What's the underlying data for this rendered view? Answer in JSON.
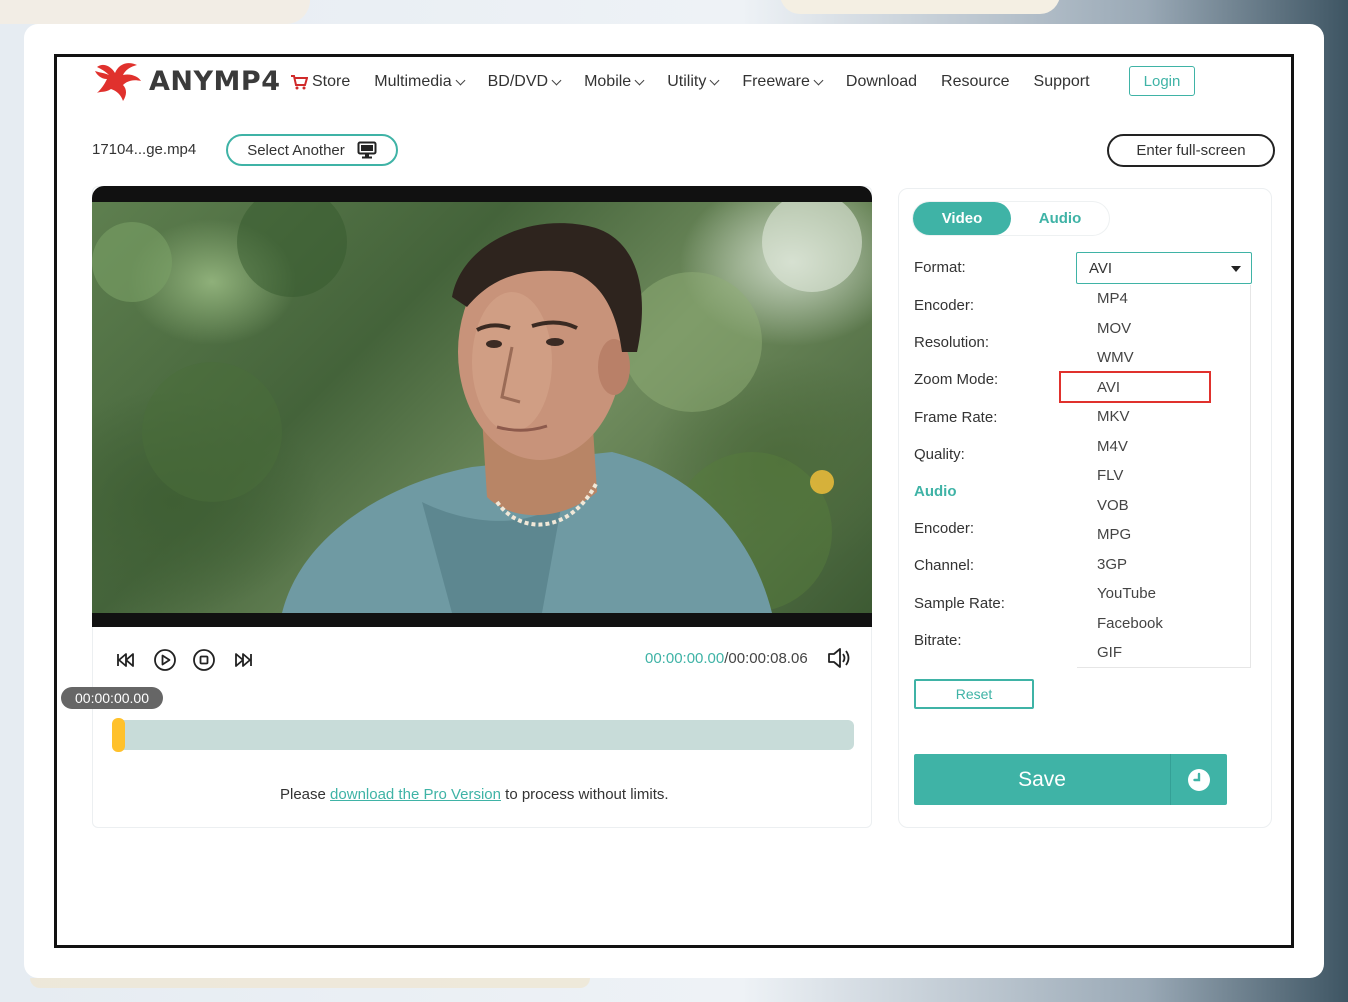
{
  "brand": {
    "name": "ANYMP4"
  },
  "nav": {
    "store": "Store",
    "items": [
      {
        "label": "Multimedia",
        "has_dropdown": true
      },
      {
        "label": "BD/DVD",
        "has_dropdown": true
      },
      {
        "label": "Mobile",
        "has_dropdown": true
      },
      {
        "label": "Utility",
        "has_dropdown": true
      },
      {
        "label": "Freeware",
        "has_dropdown": true
      },
      {
        "label": "Download",
        "has_dropdown": false
      },
      {
        "label": "Resource",
        "has_dropdown": false
      },
      {
        "label": "Support",
        "has_dropdown": false
      }
    ],
    "login": "Login"
  },
  "file": {
    "name": "17104...ge.mp4",
    "select_another": "Select Another",
    "fullscreen": "Enter full-screen"
  },
  "player": {
    "current_time": "00:00:00.00",
    "total_time": "/00:00:08.06",
    "badge_time": "00:00:00.00",
    "progress": 0.0
  },
  "promo": {
    "prefix": "Please ",
    "link": "download the Pro Version",
    "suffix": " to process without limits."
  },
  "settings": {
    "tabs": [
      "Video",
      "Audio"
    ],
    "active_tab": "Video",
    "labels": {
      "format": "Format:",
      "encoder": "Encoder:",
      "resolution": "Resolution:",
      "zoom_mode": "Zoom Mode:",
      "frame_rate": "Frame Rate:",
      "quality": "Quality:",
      "audio_section": "Audio",
      "audio_encoder": "Encoder:",
      "channel": "Channel:",
      "sample_rate": "Sample Rate:",
      "bitrate": "Bitrate:"
    },
    "format_selected": "AVI",
    "format_options": [
      "MP4",
      "MOV",
      "WMV",
      "AVI",
      "MKV",
      "M4V",
      "FLV",
      "VOB",
      "MPG",
      "3GP",
      "YouTube",
      "Facebook",
      "GIF"
    ],
    "highlighted_option": "AVI",
    "reset": "Reset",
    "save": "Save"
  },
  "colors": {
    "accent": "#3fb3a6",
    "handle": "#ffc12b",
    "highlight_border": "#e0312d",
    "brand_red": "#e0312d"
  }
}
